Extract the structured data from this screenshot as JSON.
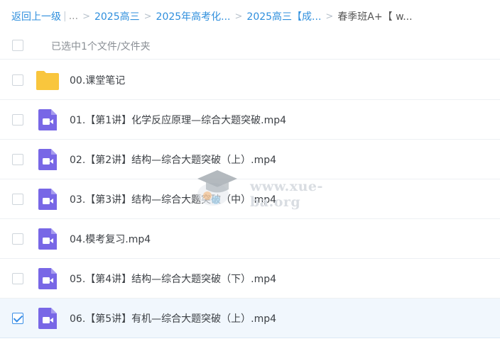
{
  "breadcrumb": {
    "back": "返回上一级",
    "ellipsis": "...",
    "crumbs": [
      "2025高三",
      "2025年高考化...",
      "2025高三【成..."
    ],
    "current": "春季班A+【 w..."
  },
  "header": {
    "selected_text": "已选中1个文件/文件夹"
  },
  "files": [
    {
      "name": "00.课堂笔记",
      "type": "folder",
      "checked": false
    },
    {
      "name": "01.【第1讲】化学反应原理—综合大题突破.mp4",
      "type": "video",
      "checked": false
    },
    {
      "name": "02.【第2讲】结构—综合大题突破（上）.mp4",
      "type": "video",
      "checked": false
    },
    {
      "name": "03.【第3讲】结构—综合大题突破（中）.mp4",
      "type": "video",
      "checked": false
    },
    {
      "name": "04.模考复习.mp4",
      "type": "video",
      "checked": false
    },
    {
      "name": "05.【第4讲】结构—综合大题突破（下）.mp4",
      "type": "video",
      "checked": false
    },
    {
      "name": "06.【第5讲】有机—综合大题突破（上）.mp4",
      "type": "video",
      "checked": true
    }
  ],
  "watermark": {
    "text": "www.xue-ba.org",
    "icon": "graduation-cap-icon"
  },
  "icons": {
    "folder": "folder-icon",
    "video": "video-file-icon"
  },
  "colors": {
    "accent": "#2f8fdd",
    "folder": "#f9c53d",
    "video": "#7867e6",
    "selected_row": "#f1f7fd"
  }
}
